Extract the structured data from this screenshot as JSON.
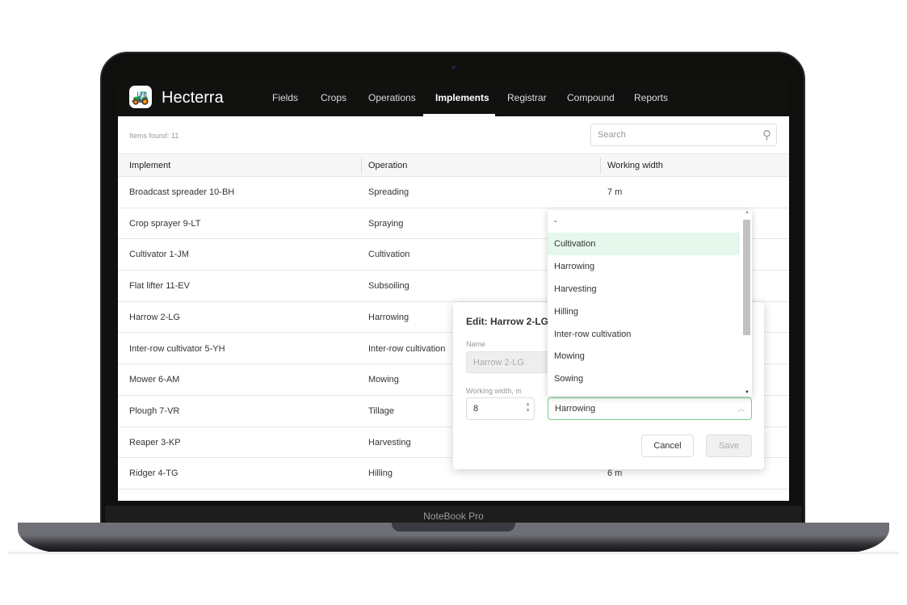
{
  "device": {
    "brand": "NoteBook Pro"
  },
  "app": {
    "title": "Hecterra",
    "logo_icon": "tractor-icon"
  },
  "nav": {
    "items": [
      {
        "label": "Fields"
      },
      {
        "label": "Crops"
      },
      {
        "label": "Operations"
      },
      {
        "label": "Implements",
        "active": true
      },
      {
        "label": "Registrar"
      },
      {
        "label": "Compound"
      },
      {
        "label": "Reports"
      }
    ]
  },
  "toolbar": {
    "items_found": "Items found: 11",
    "search_placeholder": "Search"
  },
  "table": {
    "headers": [
      "Implement",
      "Operation",
      "Working width"
    ],
    "rows": [
      {
        "implement": "Broadcast spreader 10-BH",
        "operation": "Spreading",
        "width": "7 m"
      },
      {
        "implement": "Crop sprayer 9-LT",
        "operation": "Spraying",
        "width": ""
      },
      {
        "implement": "Cultivator 1-JM",
        "operation": "Cultivation",
        "width": ""
      },
      {
        "implement": "Flat lifter 11-EV",
        "operation": "Subsoiling",
        "width": ""
      },
      {
        "implement": "Harrow 2-LG",
        "operation": "Harrowing",
        "width": ""
      },
      {
        "implement": "Inter-row cultivator 5-YH",
        "operation": "Inter-row cultivation",
        "width": ""
      },
      {
        "implement": "Mower 6-AM",
        "operation": "Mowing",
        "width": ""
      },
      {
        "implement": "Plough 7-VR",
        "operation": "Tillage",
        "width": ""
      },
      {
        "implement": "Reaper 3-KP",
        "operation": "Harvesting",
        "width": ""
      },
      {
        "implement": "Ridger 4-TG",
        "operation": "Hilling",
        "width": "6 m"
      }
    ]
  },
  "modal": {
    "title": "Edit: Harrow 2-LG",
    "name_label": "Name",
    "name_value": "Harrow 2-LG",
    "width_label": "Working width, m",
    "width_value": "8",
    "operation_value": "Harrowing",
    "cancel_label": "Cancel",
    "save_label": "Save"
  },
  "dropdown": {
    "options": [
      "-",
      "Cultivation",
      "Harrowing",
      "Harvesting",
      "Hilling",
      "Inter-row cultivation",
      "Mowing",
      "Sowing"
    ],
    "highlighted": "Cultivation"
  },
  "colors": {
    "accent": "#6fd18c",
    "highlight": "#e6f7ec",
    "nav_bg": "#111110"
  }
}
